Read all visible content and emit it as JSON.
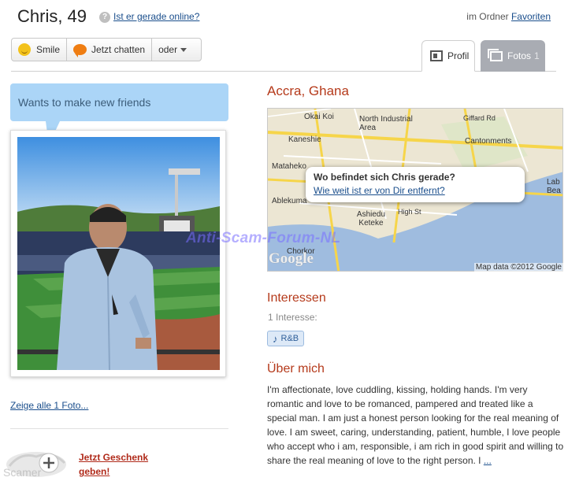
{
  "header": {
    "name_age": "Chris, 49",
    "help_glyph": "?",
    "online_link": "Ist er gerade online?",
    "folder_prefix": "im Ordner",
    "folder_link": "Favoriten"
  },
  "actions": {
    "smile": "Smile",
    "chat": "Jetzt chatten",
    "more": "oder"
  },
  "tabs": {
    "profil": "Profil",
    "fotos": "Fotos",
    "fotos_count": "1"
  },
  "status_message": "Wants to make new friends",
  "photo_link": "Zeige alle 1 Foto...",
  "gift": {
    "line1": "Jetzt Geschenk",
    "line2": "geben!"
  },
  "location": {
    "title": "Accra, Ghana",
    "popup_question": "Wo befindet sich Chris gerade?",
    "popup_link": "Wie weit ist er von Dir entfernt?",
    "map_labels": [
      "Okai Koi",
      "North Industrial Area",
      "Giffard Rd",
      "Kaneshie",
      "Cantonments",
      "Mataheko",
      "Ablekuma",
      "Ashiedu Keteke",
      "Chorkor",
      "High St",
      "Lab Bea"
    ],
    "map_copyright": "Map data ©2012 Google",
    "map_logo": "Google"
  },
  "interests": {
    "title": "Interessen",
    "count_label": "1 Interesse:",
    "tags": [
      "R&B"
    ]
  },
  "about": {
    "title": "Über mich",
    "text": "I'm affectionate, love cuddling, kissing, holding hands. I'm very romantic and love to be romanced, pampered and treated like a special man. I am just a honest person looking for the real meaning of love. I am sweet, caring, understanding, patient, humble, I love people who accept who i am, responsible, i am rich in good spirit and willing to share the real meaning of love to the right person. I",
    "more_link": "..."
  },
  "watermarks": {
    "main": "Anti-Scam-Forum-NL",
    "corner": "Scamer"
  },
  "colors": {
    "accent_title": "#b53a1b",
    "status_bubble": "#abd5f7",
    "link": "#1a4e8c",
    "tab_inactive": "#a9acb3"
  }
}
